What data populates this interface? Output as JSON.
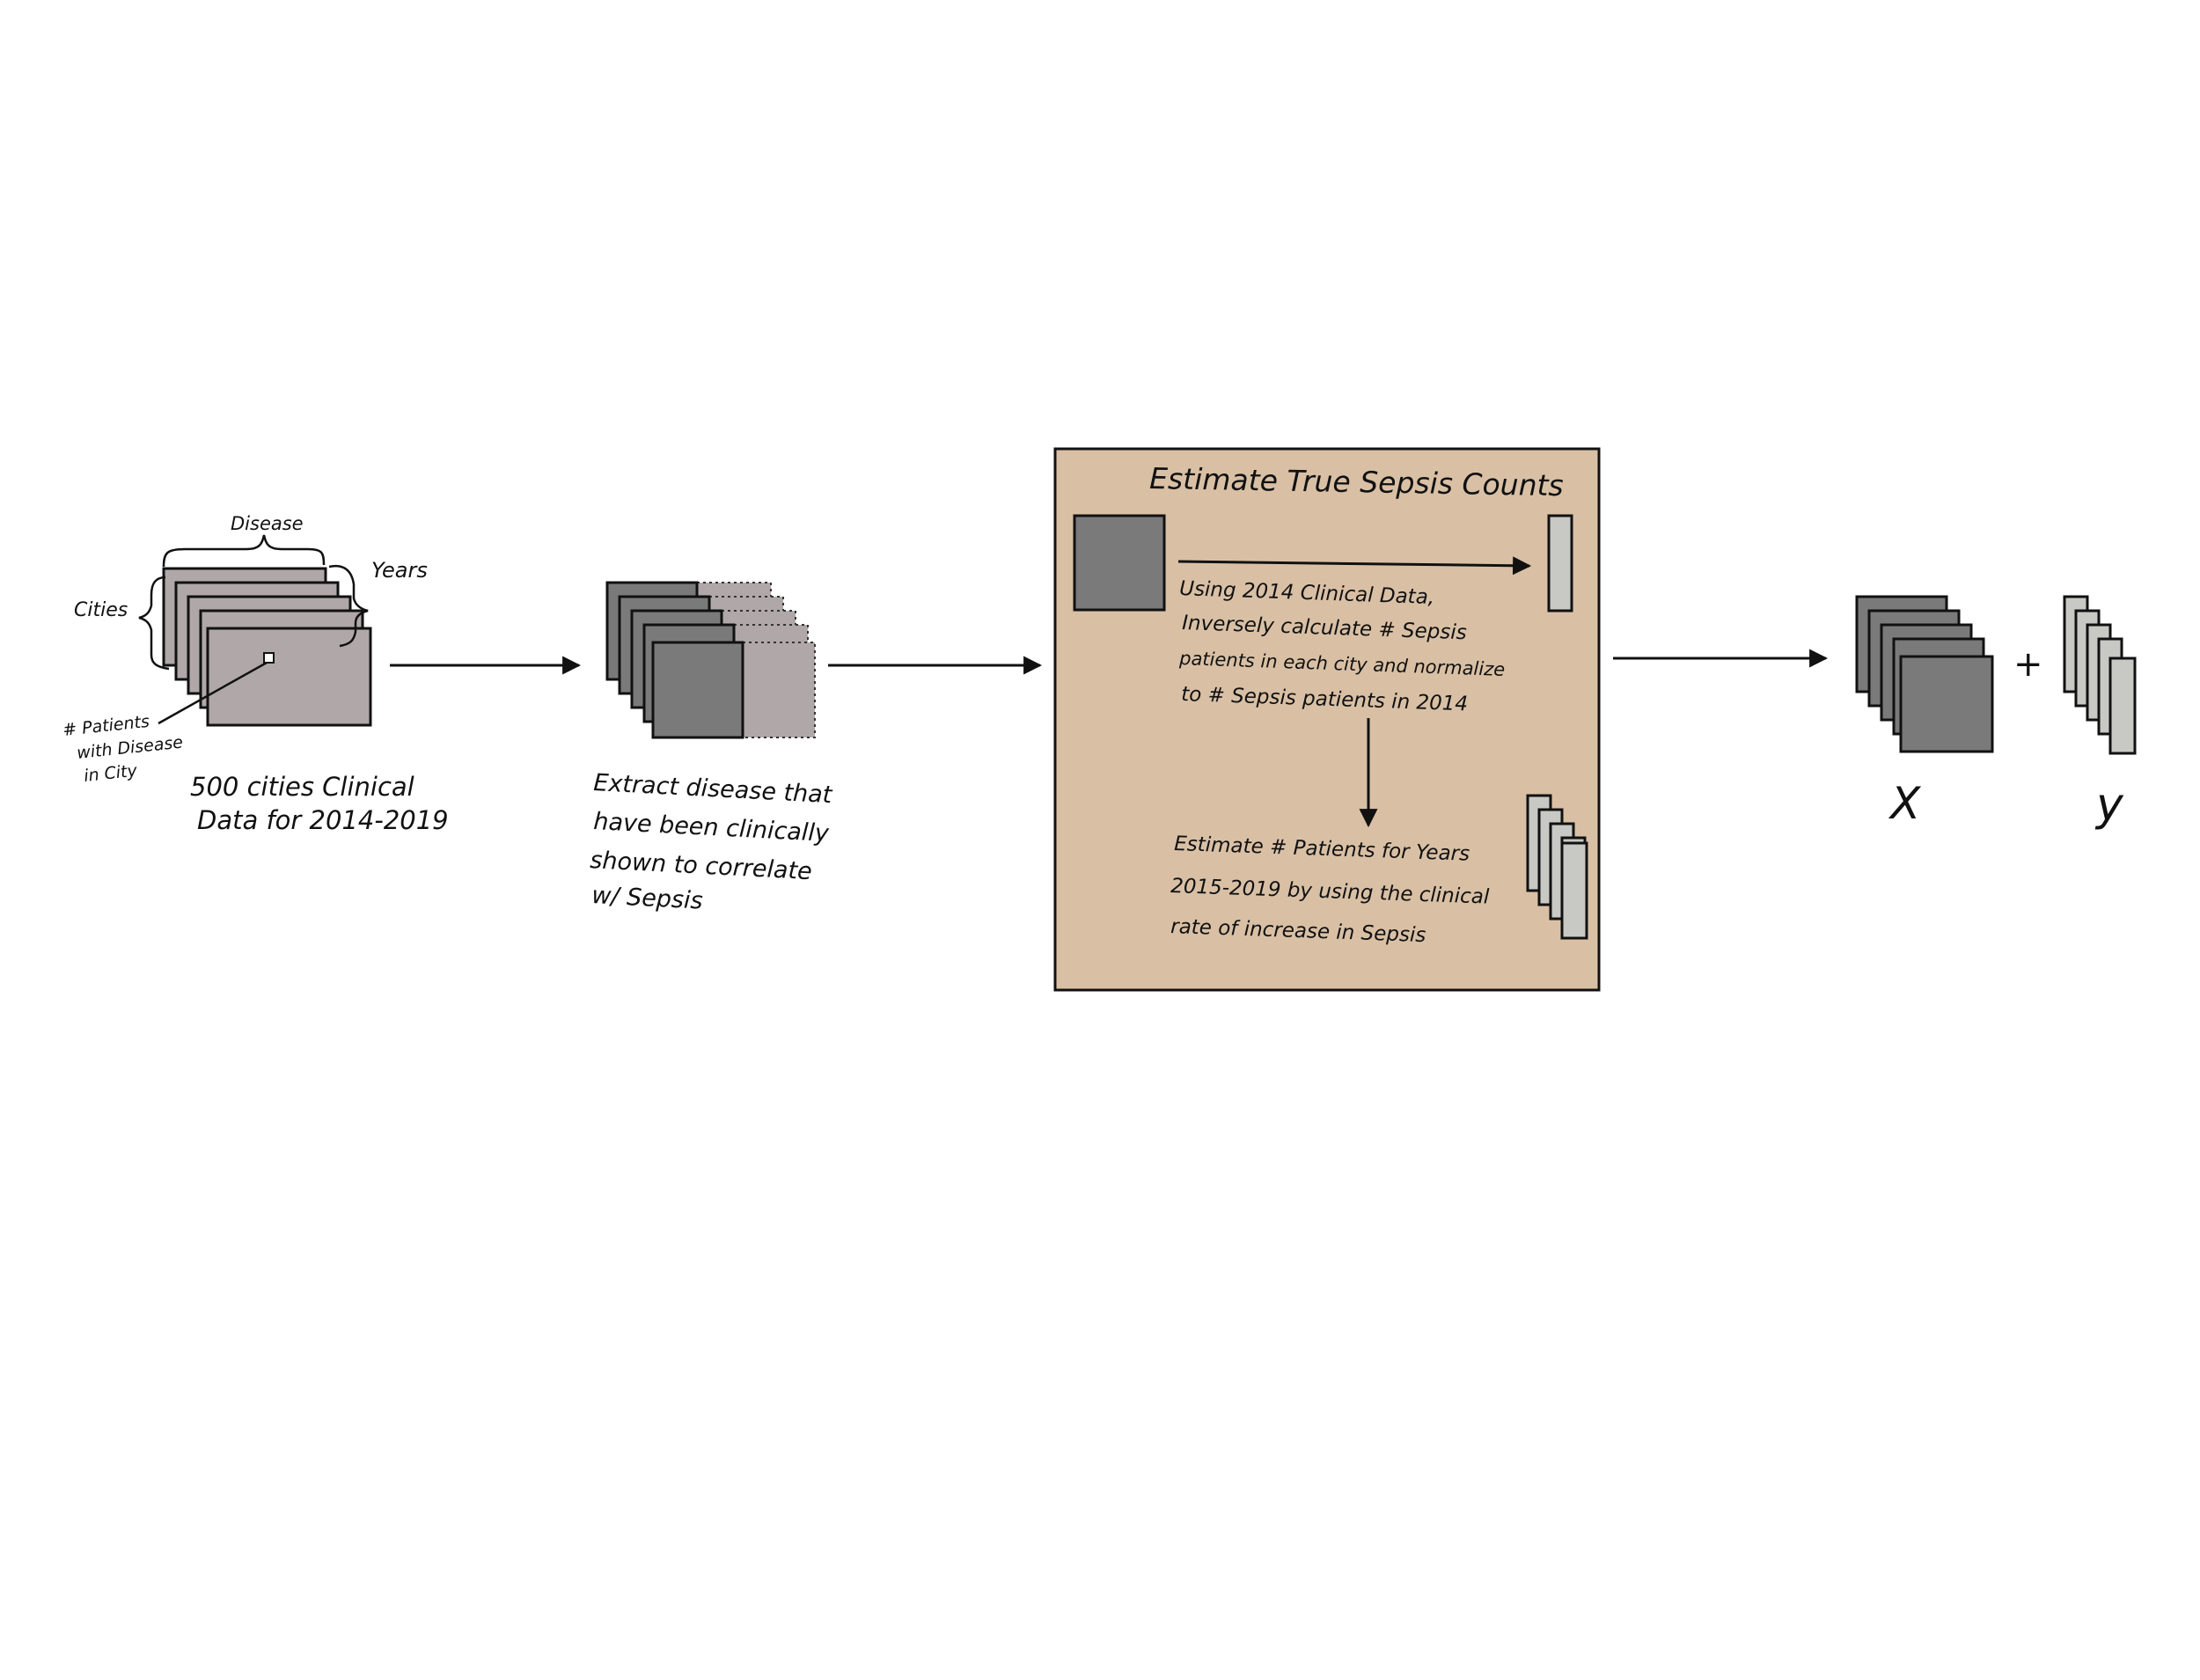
{
  "colors": {
    "background": "#ffffff",
    "panel_fill": "#d9c0a5",
    "dark_gray": "#7a7a7a",
    "mauve_gray": "#b0a8a8",
    "light_gray": "#c8c8c4",
    "stroke": "#111111"
  },
  "stage1": {
    "label_disease": "Disease",
    "label_years": "Years",
    "label_cities": "Cities",
    "callout_lines": [
      "# Patients",
      "with Disease",
      "in City"
    ],
    "caption_lines": [
      "500 cities Clinical",
      "Data for 2014-2019"
    ]
  },
  "stage2": {
    "caption_lines": [
      "Extract disease that",
      "have been clinically",
      "shown to correlate",
      "w/ Sepsis"
    ]
  },
  "stage3": {
    "title": "Estimate True Sepsis Counts",
    "step1_lines": [
      "Using 2014 Clinical Data,",
      "Inversely calculate # Sepsis",
      "patients in each city and normalize",
      "to # Sepsis patients in 2014"
    ],
    "step2_lines": [
      "Estimate # Patients for Years",
      "2015-2019 by using the clinical",
      "rate of increase in Sepsis"
    ]
  },
  "output": {
    "x_label": "X",
    "plus": "+",
    "y_label": "y"
  }
}
